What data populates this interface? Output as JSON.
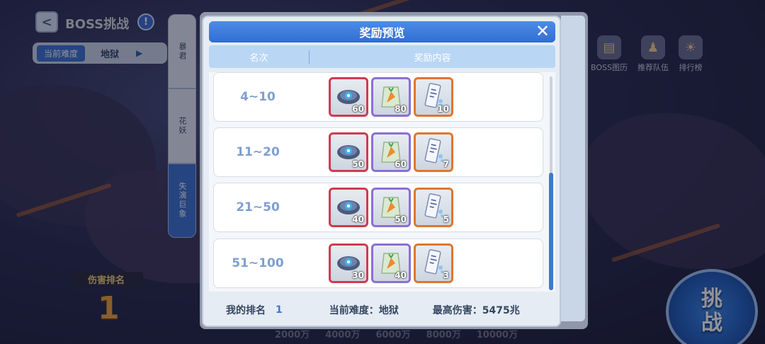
{
  "background": {
    "title": "BOSS挑战",
    "help_symbol": "!",
    "back_symbol": "<",
    "difficulty_label": "当前难度",
    "difficulty_value": "地狱",
    "boss_tabs": [
      {
        "label": "暴君",
        "active": false
      },
      {
        "label": "花妖",
        "active": false
      },
      {
        "label": "失演巨象",
        "active": true
      }
    ],
    "right_icons": [
      {
        "label": "BOSS图历",
        "icon": "book-icon",
        "symbol": "▤"
      },
      {
        "label": "推荐队伍",
        "icon": "team-icon",
        "symbol": "♟"
      },
      {
        "label": "排行榜",
        "icon": "trophy-icon",
        "symbol": "☀"
      }
    ],
    "damage_rank_label": "伤害排名",
    "damage_rank_value": "1",
    "scale_labels": [
      "2000万",
      "4000万",
      "6000万",
      "8000万",
      "10000万"
    ],
    "challenge_label_line1": "挑",
    "challenge_label_line2": "战"
  },
  "modal": {
    "title": "奖励预览",
    "close_symbol": "✕",
    "col_rank": "名次",
    "col_rewards": "奖励内容",
    "rows": [
      {
        "rank": "4~10",
        "items": [
          {
            "icon": "gear-part-icon",
            "count": "60"
          },
          {
            "icon": "carrot-bag-icon",
            "count": "80"
          },
          {
            "icon": "ticket-icon",
            "count": "10"
          }
        ]
      },
      {
        "rank": "11~20",
        "items": [
          {
            "icon": "gear-part-icon",
            "count": "50"
          },
          {
            "icon": "carrot-bag-icon",
            "count": "60"
          },
          {
            "icon": "ticket-icon",
            "count": "7"
          }
        ]
      },
      {
        "rank": "21~50",
        "items": [
          {
            "icon": "gear-part-icon",
            "count": "40"
          },
          {
            "icon": "carrot-bag-icon",
            "count": "50"
          },
          {
            "icon": "ticket-icon",
            "count": "5"
          }
        ]
      },
      {
        "rank": "51~100",
        "items": [
          {
            "icon": "gear-part-icon",
            "count": "30"
          },
          {
            "icon": "carrot-bag-icon",
            "count": "40"
          },
          {
            "icon": "ticket-icon",
            "count": "3"
          }
        ]
      }
    ],
    "footer": {
      "my_rank_label": "我的排名",
      "my_rank_value": "1",
      "difficulty": "当前难度：地狱",
      "max_damage": "最高伤害：5475兆"
    }
  },
  "colors": {
    "accent": "#3f78d2",
    "rarity_red": "#d13a52",
    "rarity_purple": "#8b6fd6",
    "rarity_orange": "#e0762f"
  }
}
